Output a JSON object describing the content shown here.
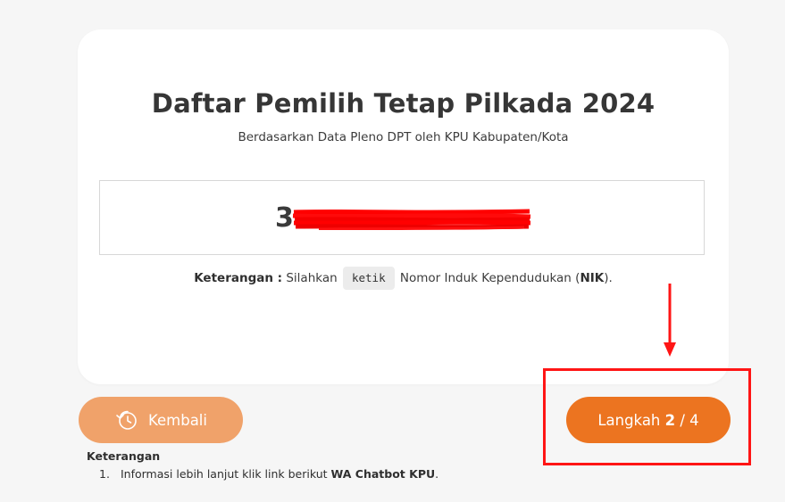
{
  "card": {
    "title": "Daftar Pemilih Tetap Pilkada 2024",
    "subtitle": "Berdasarkan Data Pleno DPT oleh KPU Kabupaten/Kota",
    "nik_input": {
      "visible_prefix": "3"
    },
    "note": {
      "label": "Keterangan :",
      "text_before": "Silahkan",
      "code": "ketik",
      "text_after": "Nomor Induk Kependudukan (",
      "bold_term": "NIK",
      "text_end": ")."
    }
  },
  "buttons": {
    "back_label": "Kembali",
    "back_icon": "history-clock-icon",
    "next_label_prefix": "Langkah",
    "next_step_current": "2",
    "next_step_separator": "/ 4"
  },
  "info": {
    "title": "Keterangan",
    "items": [
      {
        "number": "1.",
        "text": "Informasi lebih lanjut klik link berikut",
        "link": "WA Chatbot KPU",
        "end": "."
      }
    ]
  },
  "colors": {
    "page_background": "#f6f6f6",
    "card_background": "#ffffff",
    "back_button": "#f0a26a",
    "next_button": "#ec7420",
    "annotation_red": "#ff1515"
  }
}
